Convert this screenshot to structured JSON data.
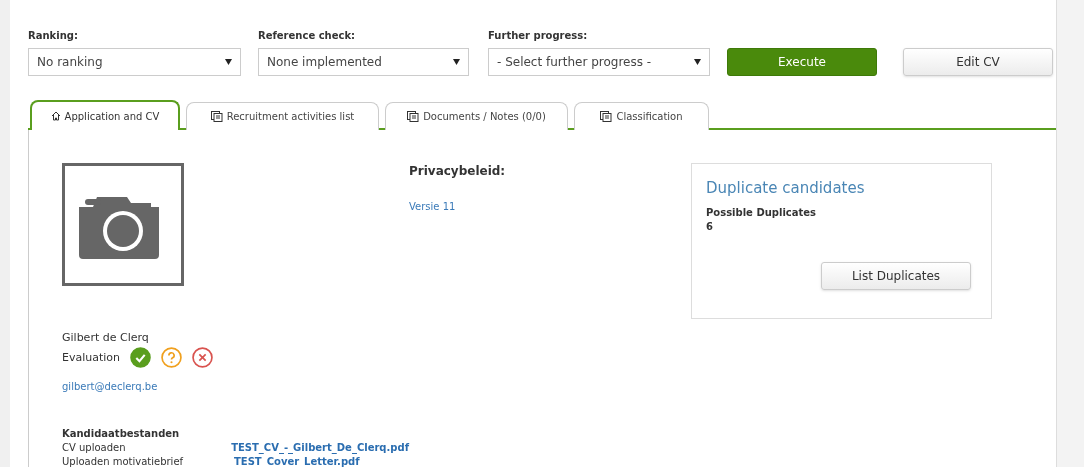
{
  "filters": [
    {
      "label": "Ranking:",
      "value": "No ranking"
    },
    {
      "label": "Reference check:",
      "value": "None implemented"
    },
    {
      "label": "Further progress:",
      "value": "- Select further progress -"
    }
  ],
  "buttons": [
    {
      "label": "Execute",
      "kind": "primary"
    },
    {
      "label": "Edit CV",
      "kind": "default"
    }
  ],
  "tabs": [
    {
      "label": "Application and CV",
      "kind": "home",
      "selected": true
    },
    {
      "label": "Recruitment activities list",
      "kind": "docs",
      "selected": false
    },
    {
      "label": "Documents / Notes (0/0)",
      "kind": "docs",
      "selected": false
    },
    {
      "label": "Classification",
      "kind": "docs",
      "selected": false
    }
  ],
  "candidate": {
    "name": "Gilbert de Clerq",
    "evaluation_label": "Evaluation",
    "email": "gilbert@declerq.be",
    "evaluation": [
      {
        "kind": "check",
        "color": "#5a9e1e",
        "selected": true
      },
      {
        "kind": "question",
        "color": "#f0a01e",
        "selected": false
      },
      {
        "kind": "cross",
        "color": "#d9534f",
        "selected": false
      }
    ]
  },
  "privacy": {
    "title": "Privacybeleid:",
    "link": "Versie 11"
  },
  "duplicates": {
    "title": "Duplicate candidates",
    "label": "Possible Duplicates",
    "count": "6",
    "button": "List Duplicates"
  },
  "files": {
    "title": "Kandidaatbestanden",
    "rows": [
      {
        "label": "CV uploaden",
        "file": "TEST_CV_-_Gilbert_De_Clerq.pdf"
      },
      {
        "label": "Uploaden motivatiebrief",
        "file": "TEST_Cover_Letter.pdf"
      }
    ]
  }
}
